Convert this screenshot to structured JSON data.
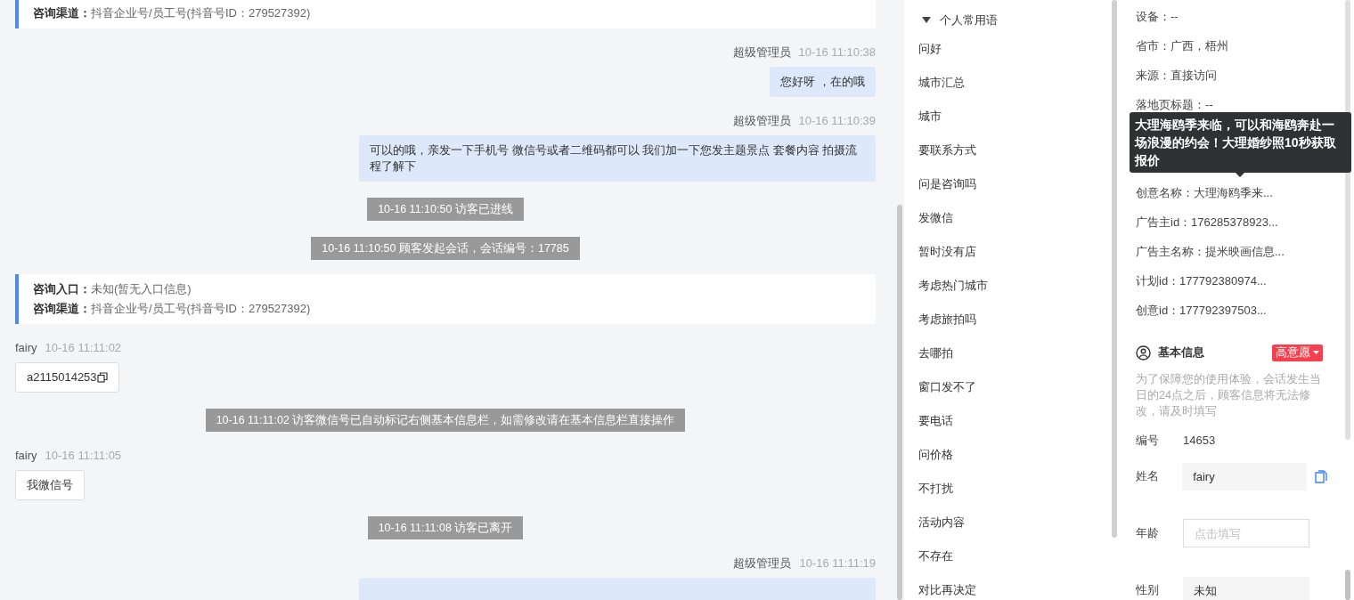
{
  "chat": [
    {
      "kind": "info-card",
      "lines": [
        {
          "label": "咨询渠道：",
          "value": "抖音企业号/员工号(抖音号ID：279527392)"
        }
      ]
    },
    {
      "kind": "agent",
      "sender": "超级管理员",
      "time": "10-16 11:10:38",
      "text": "您好呀 ，在的哦"
    },
    {
      "kind": "agent",
      "sender": "超级管理员",
      "time": "10-16 11:10:39",
      "text": "可以的哦，亲发一下手机号 微信号或者二维码都可以 我们加一下您发主题景点 套餐内容 拍摄流程了解下"
    },
    {
      "kind": "system",
      "text": "10-16 11:10:50 访客已进线"
    },
    {
      "kind": "system",
      "text": "10-16 11:10:50 顾客发起会话，会话编号：17785"
    },
    {
      "kind": "info-card",
      "lines": [
        {
          "label": "咨询入口：",
          "value": "未知(暂无入口信息)"
        },
        {
          "label": "咨询渠道：",
          "value": "抖音企业号/员工号(抖音号ID：279527392)"
        }
      ]
    },
    {
      "kind": "visitor",
      "sender": "fairy",
      "time": "10-16 11:11:02",
      "text": "a2115014253",
      "copy": true
    },
    {
      "kind": "system",
      "text": "10-16 11:11:02 访客微信号已自动标记右侧基本信息栏，如需修改请在基本信息栏直接操作"
    },
    {
      "kind": "visitor",
      "sender": "fairy",
      "time": "10-16 11:11:05",
      "text": "我微信号",
      "copy": false
    },
    {
      "kind": "system",
      "text": "10-16 11:11:08 访客已离开"
    },
    {
      "kind": "agent",
      "sender": "超级管理员",
      "time": "10-16 11:11:19"
    }
  ],
  "phrases": {
    "title": "个人常用语",
    "expanded": true,
    "items": [
      "问好",
      "城市汇总",
      "城市",
      "要联系方式",
      "问是咨询吗",
      "发微信",
      "暂时没有店",
      "考虑热门城市",
      "考虑旅拍吗",
      "去哪拍",
      "窗口发不了",
      "要电话",
      "问价格",
      "不打扰",
      "活动内容",
      "不存在",
      "对比再决定"
    ]
  },
  "visitor_info": [
    {
      "text": "设备：--"
    },
    {
      "text": "省市：广西，梧州"
    },
    {
      "text": "来源：直接访问"
    },
    {
      "text": "落地页标题：--"
    },
    {
      "text": "创意名称：大理海鸥季来..."
    },
    {
      "text": "广告主id：176285378923..."
    },
    {
      "text": "广告主名称：提米映画信息..."
    },
    {
      "text": "计划id：177792380974..."
    },
    {
      "text": "创意id：177792397503..."
    }
  ],
  "tooltip": "大理海鸥季来临，可以和海鸥奔赴一场浪漫的约会！大理婚纱照10秒获取报价",
  "basic_info": {
    "title": "基本信息",
    "intent": "高意愿",
    "note": "为了保障您的使用体验，会话发生当日的24点之后，顾客信息将无法修改，请及时填写",
    "fields": [
      {
        "kind": "text",
        "label": "编号",
        "value": "14653"
      },
      {
        "kind": "filled",
        "label": "姓名",
        "value": "fairy"
      },
      {
        "kind": "input",
        "label": "年龄",
        "placeholder": "点击填写"
      },
      {
        "kind": "filled-plain",
        "label": "性别",
        "value": "未知"
      }
    ]
  }
}
